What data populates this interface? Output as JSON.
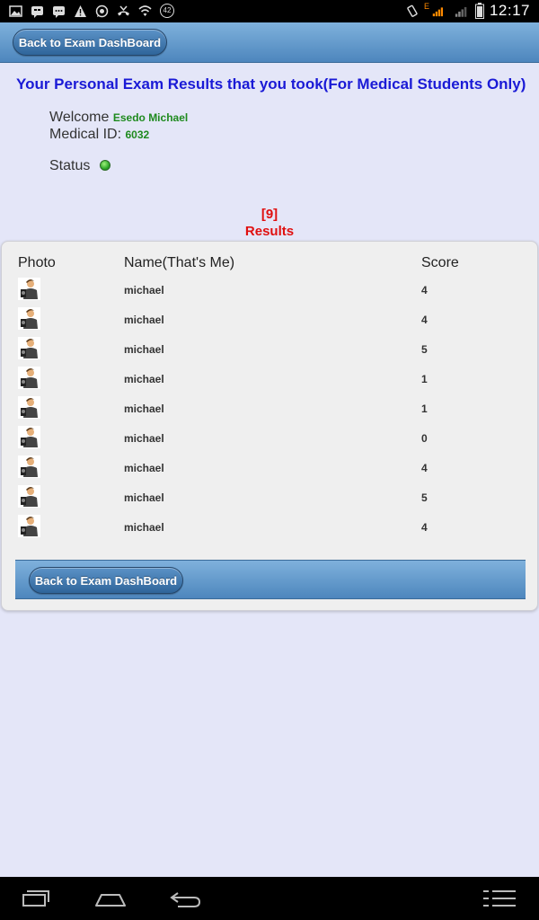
{
  "status_bar": {
    "time": "12:17",
    "notification_count": "42",
    "network_letter": "E"
  },
  "header": {
    "back_label": "Back to Exam DashBoard"
  },
  "page": {
    "title": "Your Personal Exam Results that you took(For Medical Students Only)",
    "welcome_label": "Welcome",
    "welcome_name": "Esedo Michael",
    "medical_id_label": "Medical ID:",
    "medical_id": "6032",
    "status_label": "Status",
    "result_count": "[9]",
    "results_label": "Results"
  },
  "table": {
    "headers": [
      "Photo",
      "Name(That's Me)",
      "Score"
    ],
    "rows": [
      {
        "name": "michael",
        "score": "4"
      },
      {
        "name": "michael",
        "score": "4"
      },
      {
        "name": "michael",
        "score": "5"
      },
      {
        "name": "michael",
        "score": "1"
      },
      {
        "name": "michael",
        "score": "1"
      },
      {
        "name": "michael",
        "score": "0"
      },
      {
        "name": "michael",
        "score": "4"
      },
      {
        "name": "michael",
        "score": "5"
      },
      {
        "name": "michael",
        "score": "4"
      }
    ]
  },
  "footer": {
    "back_label": "Back to Exam DashBoard"
  },
  "colors": {
    "title": "#1a1ad6",
    "accent_green": "#1e8a1e",
    "result_red": "#e01010",
    "header_blue": "#4d86bd"
  }
}
